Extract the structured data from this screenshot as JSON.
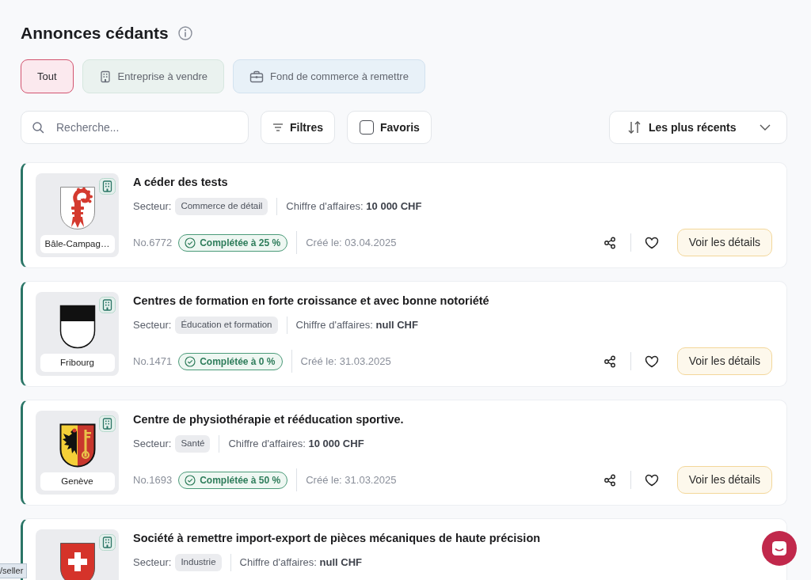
{
  "page": {
    "title": "Annonces cédants"
  },
  "type_tabs": [
    {
      "label": "Tout",
      "selected": true,
      "kind": "all"
    },
    {
      "label": "Entreprise à vendre",
      "selected": false,
      "kind": "company"
    },
    {
      "label": "Fond de commerce à remettre",
      "selected": false,
      "kind": "business"
    }
  ],
  "toolbar": {
    "search": {
      "placeholder": "Recherche..."
    },
    "filters_button": "Filtres",
    "favorites": {
      "label": "Favoris",
      "checked": false
    },
    "sort": {
      "value": "Les plus récents"
    }
  },
  "listings": [
    {
      "title": "A céder des tests",
      "sector_label": "Secteur:",
      "sector": "Commerce de détail",
      "revenue": "Chiffre d'affaires: **10 000 CHF**",
      "number": "No.6772",
      "completion": "Complétée à 25 %",
      "created": "Créé le: 03.04.2025",
      "action": "Voir les détails",
      "logo": {
        "kind": "crozier",
        "label": "Bâle-Campag…"
      }
    },
    {
      "title": "Centres de formation en forte croissance et avec bonne notoriété",
      "sector_label": "Secteur:",
      "sector": "Éducation et formation",
      "revenue": "Chiffre d'affaires: **null CHF**",
      "number": "No.1471",
      "completion": "Complétée à 0 %",
      "created": "Créé le: 31.03.2025",
      "action": "Voir les détails",
      "logo": {
        "kind": "black-white",
        "label": "Fribourg"
      }
    },
    {
      "title": "Centre de physiothérapie et rééducation sportive.",
      "sector_label": "Secteur:",
      "sector": "Santé",
      "revenue": "Chiffre d'affaires: **10 000 CHF**",
      "number": "No.1693",
      "completion": "Complétée à 50 %",
      "created": "Créé le: 31.03.2025",
      "action": "Voir les détails",
      "logo": {
        "kind": "eagle-key",
        "label": "Genève"
      }
    },
    {
      "title": "Société à remettre import-export de pièces mécaniques de haute précision",
      "sector_label": "Secteur:",
      "sector": "Industrie",
      "revenue": "Chiffre d'affaires: **null CHF**",
      "logo": {
        "kind": "cross"
      }
    }
  ],
  "link_preview": "/seller"
}
